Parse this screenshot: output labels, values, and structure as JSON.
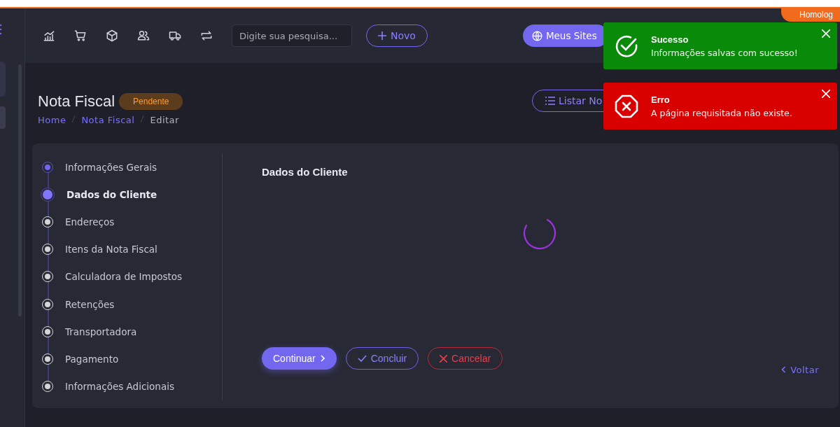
{
  "environment_badge": "Homolog",
  "search": {
    "placeholder": "Digite sua pesquisa..."
  },
  "new_button": "Novo",
  "sites_button": "Meus Sites",
  "page": {
    "title": "Nota Fiscal",
    "status": "Pendente"
  },
  "breadcrumb": [
    {
      "label": "Home",
      "link": true
    },
    {
      "label": "Nota Fiscal",
      "link": true
    },
    {
      "label": "Editar",
      "link": false
    }
  ],
  "list_button": "Listar No",
  "steps": [
    {
      "label": "Informações Gerais",
      "completed": true,
      "selected": false
    },
    {
      "label": "Dados do Cliente",
      "completed": false,
      "selected": true
    },
    {
      "label": "Endereços",
      "completed": false,
      "selected": false
    },
    {
      "label": "Itens da Nota Fiscal",
      "completed": false,
      "selected": false
    },
    {
      "label": "Calculadora de Impostos",
      "completed": false,
      "selected": false
    },
    {
      "label": "Retenções",
      "completed": false,
      "selected": false
    },
    {
      "label": "Transportadora",
      "completed": false,
      "selected": false
    },
    {
      "label": "Pagamento",
      "completed": false,
      "selected": false
    },
    {
      "label": "Informações Adicionais",
      "completed": false,
      "selected": false
    }
  ],
  "section_title": "Dados do Cliente",
  "actions": {
    "continue": "Continuar",
    "finish": "Concluir",
    "cancel": "Cancelar",
    "back": "Voltar"
  },
  "toasts": [
    {
      "kind": "success",
      "title": "Sucesso",
      "message": "Informações salvas com sucesso!"
    },
    {
      "kind": "error",
      "title": "Erro",
      "message": "A página requisitada não existe."
    }
  ]
}
